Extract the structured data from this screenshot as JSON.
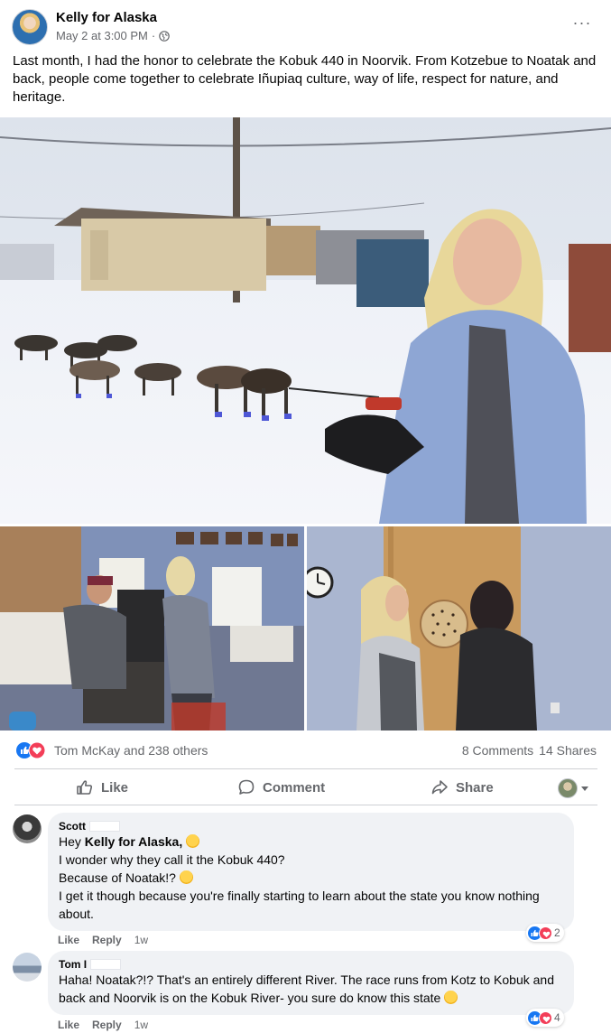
{
  "post": {
    "author": "Kelly for Alaska",
    "timestamp": "May 2 at 3:00 PM",
    "separator": "·",
    "privacy_icon": "globe-icon",
    "more_label": "···",
    "text": "Last month, I had the honor to celebrate the Kobuk 440 in Noorvik. From Kotzebue to Noatak and back, people come together to celebrate Iñupiaq culture, way of life, respect for nature, and heritage."
  },
  "reactions": {
    "icons": [
      "like-icon",
      "love-icon"
    ],
    "names": "Tom McKay and 238 others",
    "comments": "8 Comments",
    "shares": "14 Shares"
  },
  "actions": {
    "like": "Like",
    "comment": "Comment",
    "share": "Share"
  },
  "comments": [
    {
      "author": "Scott",
      "mention": "Kelly for Alaska,",
      "lines": [
        "I wonder why they call it the Kobuk 440?",
        "Because of Noatak!?",
        "I get it though because you're finally starting to learn about the state you know nothing about."
      ],
      "like": "Like",
      "reply": "Reply",
      "age": "1w",
      "reaction_count": "2"
    },
    {
      "author": "Tom I",
      "text": "Haha! Noatak?!? That's an entirely different River. The race runs from Kotz to Kobuk and back and Noorvik is on the Kobuk River- you sure do know this state",
      "like": "Like",
      "reply": "Reply",
      "age": "1w",
      "reaction_count": "4"
    }
  ],
  "colors": {
    "accent": "#1877f2",
    "love": "#f33e58",
    "secondary_text": "#65676b",
    "bubble": "#f0f2f5"
  }
}
